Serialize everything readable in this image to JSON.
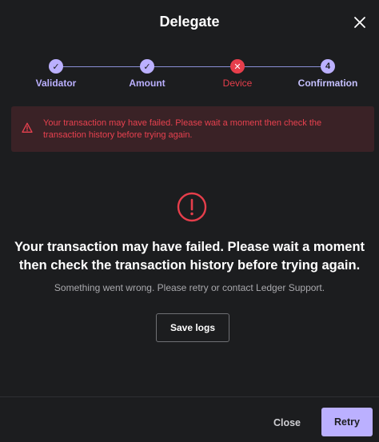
{
  "modal": {
    "title": "Delegate"
  },
  "stepper": {
    "steps": [
      {
        "label": "Validator",
        "state": "done",
        "marker": "✓"
      },
      {
        "label": "Amount",
        "state": "done",
        "marker": "✓"
      },
      {
        "label": "Device",
        "state": "error",
        "marker": "✕"
      },
      {
        "label": "Confirmation",
        "state": "pending",
        "marker": "4"
      }
    ]
  },
  "alert": {
    "text": "Your transaction may have failed. Please wait a moment then check the transaction history before trying again."
  },
  "main": {
    "headline": "Your transaction may have failed. Please wait a moment then check the transaction history before trying again.",
    "subtext": "Something went wrong. Please retry or contact Ledger Support.",
    "save_logs_label": "Save logs"
  },
  "footer": {
    "close_label": "Close",
    "retry_label": "Retry"
  },
  "colors": {
    "accent": "#bbb0ff",
    "error": "#e63e4b",
    "background": "#1c1d1f"
  }
}
